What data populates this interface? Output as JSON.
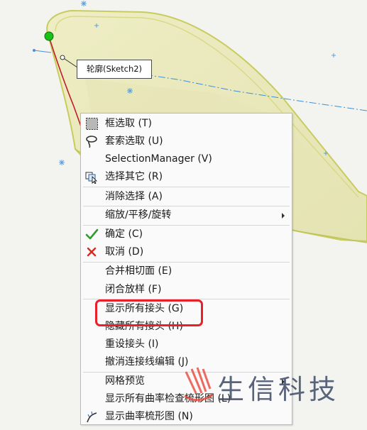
{
  "tooltip": {
    "text": "轮廓(Sketch2)"
  },
  "menu": {
    "items": [
      {
        "label": "框选取 (T)",
        "icon": "box-select-icon"
      },
      {
        "label": "套索选取 (U)",
        "icon": "lasso-select-icon"
      },
      {
        "label": "SelectionManager (V)",
        "icon": ""
      },
      {
        "label": "选择其它 (R)",
        "icon": "select-other-icon"
      },
      {
        "label": "消除选择 (A)",
        "icon": ""
      },
      {
        "label": "缩放/平移/旋转",
        "icon": "",
        "submenu": true
      },
      {
        "label": "确定 (C)",
        "icon": "checkmark-icon"
      },
      {
        "label": "取消 (D)",
        "icon": "cancel-x-icon"
      },
      {
        "label": "合并相切面 (E)",
        "icon": ""
      },
      {
        "label": "闭合放样 (F)",
        "icon": ""
      },
      {
        "label": "显示所有接头 (G)",
        "icon": ""
      },
      {
        "label": "隐藏所有接头 (H)",
        "icon": ""
      },
      {
        "label": "重设接头 (I)",
        "icon": ""
      },
      {
        "label": "撤消连接线编辑 (J)",
        "icon": ""
      },
      {
        "label": "网格预览",
        "icon": "",
        "submenu": true
      },
      {
        "label": "显示所有曲率检查梳形图 (L)",
        "icon": ""
      },
      {
        "label": "显示曲率梳形图 (N)",
        "icon": "curvature-comb-icon"
      }
    ]
  },
  "watermark": {
    "text": "生信科技"
  },
  "colors": {
    "surface_fill": "#ecebbf",
    "surface_edge": "#c8cc5e",
    "selected_point": "#19c219",
    "centerline": "#3b8fd9",
    "highlight_box": "#e8202a",
    "confirm_green": "#2f9b2f",
    "cancel_red": "#d92a1e"
  }
}
